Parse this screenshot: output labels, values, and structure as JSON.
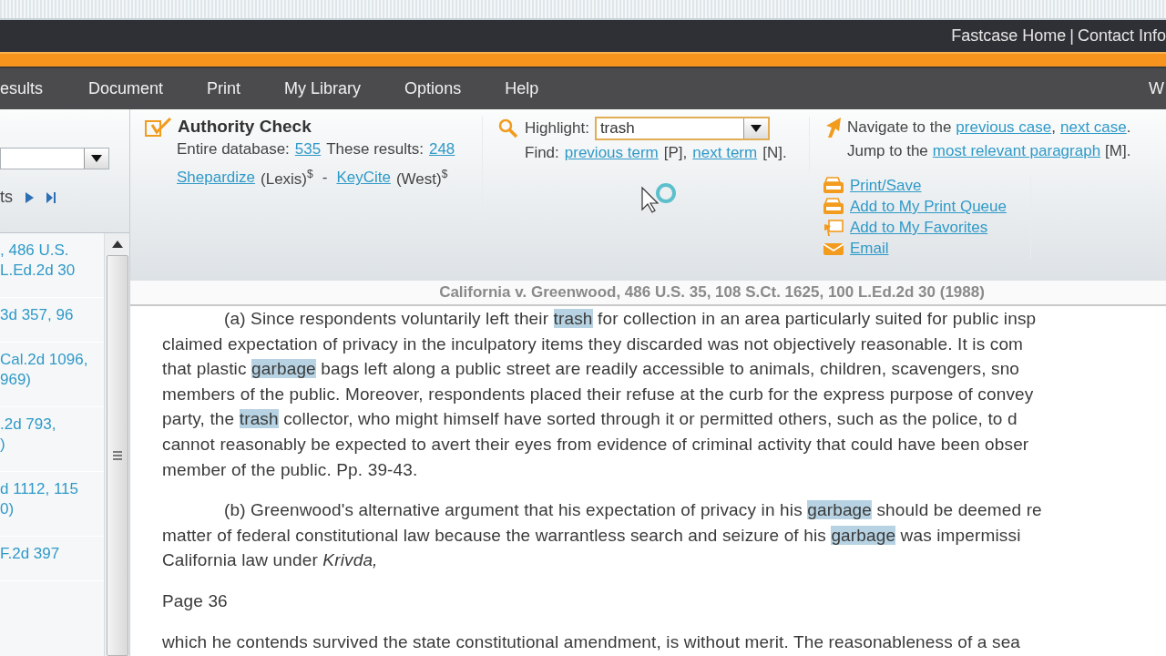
{
  "top_bar": {
    "links": [
      "Fastcase Home",
      "Contact Info"
    ],
    "separator": "|"
  },
  "menu": [
    {
      "label": "esults"
    },
    {
      "label": "Document"
    },
    {
      "label": "Print"
    },
    {
      "label": "My Library"
    },
    {
      "label": "Options"
    },
    {
      "label": "Help"
    }
  ],
  "menu_right": "W",
  "sidebar": {
    "nav_label": "ts",
    "results": [
      {
        "lines": [
          ", 486 U.S.",
          "L.Ed.2d 30"
        ]
      },
      {
        "lines": [
          "3d 357, 96"
        ]
      },
      {
        "lines": [
          "Cal.2d 1096,",
          "969)"
        ]
      },
      {
        "lines": [
          ".2d 793,",
          ")"
        ]
      },
      {
        "lines": [
          "d 1112, 115",
          "0)"
        ]
      },
      {
        "lines": [
          "F.2d 397"
        ]
      }
    ]
  },
  "authority_check": {
    "title": "Authority Check",
    "entire_label": "Entire database:",
    "entire_count": "535",
    "these_label": "These results:",
    "these_count": "248",
    "separator": "-",
    "services": [
      {
        "link": "Shepardize",
        "provider": "(Lexis)",
        "fee": "$"
      },
      {
        "link": "KeyCite",
        "provider": "(West)",
        "fee": "$"
      }
    ]
  },
  "highlight": {
    "label": "Highlight:",
    "value": "trash",
    "find_label": "Find:",
    "previous": "previous term",
    "previous_key": "[P],",
    "next": "next term",
    "next_key": "[N]."
  },
  "navigate": {
    "prefix": "Navigate to the",
    "previous": "previous case",
    "comma": ",",
    "next": "next case",
    "end": ".",
    "jump_prefix": "Jump to the",
    "jump_link": "most relevant paragraph",
    "jump_key": "[M]."
  },
  "actions": [
    {
      "kind": "print",
      "label": "Print/Save"
    },
    {
      "kind": "queue",
      "label": "Add to My Print Queue"
    },
    {
      "kind": "favorite",
      "label": "Add to My Favorites"
    },
    {
      "kind": "email",
      "label": "Email"
    }
  ],
  "citation": "California v. Greenwood, 486 U.S. 35, 108 S.Ct. 1625, 100 L.Ed.2d 30 (1988)",
  "document": [
    {
      "indent": true,
      "lines": [
        [
          {
            "text": "(a) Since respondents voluntarily left their ",
            "highlighted": false
          },
          {
            "text": "trash",
            "highlighted": true
          },
          {
            "text": " for collection in an area particularly suited for public insp",
            "highlighted": false
          }
        ],
        [
          {
            "text": "claimed expectation of privacy in the inculpatory items they discarded was not objectively reasonable. It is com",
            "highlighted": false
          }
        ],
        [
          {
            "text": "that plastic ",
            "highlighted": false
          },
          {
            "text": "garbage",
            "highlighted": true
          },
          {
            "text": " bags left along a public street are readily accessible to animals, children, scavengers, sno",
            "highlighted": false
          }
        ],
        [
          {
            "text": "members of the public. Moreover, respondents placed their refuse at the curb for the express purpose of convey",
            "highlighted": false
          }
        ],
        [
          {
            "text": "party, the ",
            "highlighted": false
          },
          {
            "text": "trash",
            "highlighted": true
          },
          {
            "text": " collector, who might himself have sorted through it or permitted others, such as the police, to d",
            "highlighted": false
          }
        ],
        [
          {
            "text": "cannot reasonably be expected to avert their eyes from evidence of criminal activity that could have been obser",
            "highlighted": false
          }
        ],
        [
          {
            "text": "member of the public. Pp. 39-43.",
            "highlighted": false
          }
        ]
      ]
    },
    {
      "indent": true,
      "lines": [
        [
          {
            "text": "(b) Greenwood's alternative argument that his expectation of privacy in his ",
            "highlighted": false
          },
          {
            "text": "garbage",
            "highlighted": true
          },
          {
            "text": " should be deemed re",
            "highlighted": false
          }
        ],
        [
          {
            "text": "matter of federal constitutional law because the warrantless search and seizure of his ",
            "highlighted": false
          },
          {
            "text": "garbage",
            "highlighted": true
          },
          {
            "text": " was impermissi",
            "highlighted": false
          }
        ],
        [
          {
            "text": "California law under *Krivda,*",
            "highlighted": false
          }
        ]
      ]
    },
    {
      "indent": false,
      "lines": [
        [
          {
            "text": "Page 36",
            "highlighted": false
          }
        ]
      ]
    },
    {
      "indent": false,
      "lines": [
        [
          {
            "text": "which he contends survived the state constitutional amendment, is without merit. The reasonableness of a sea",
            "highlighted": false
          }
        ]
      ]
    }
  ]
}
